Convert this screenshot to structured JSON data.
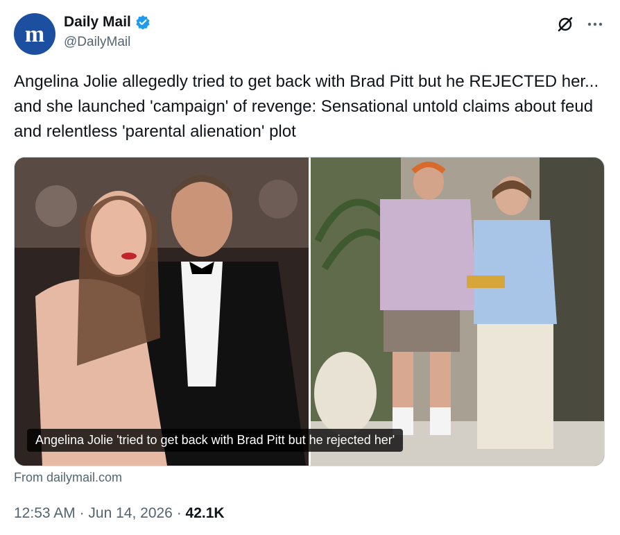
{
  "author": {
    "display_name": "Daily Mail",
    "handle": "@DailyMail",
    "avatar_letter": "m",
    "brand_color": "#1d4fa0",
    "verified_color": "#1d9bf0"
  },
  "tweet": {
    "text": "Angelina Jolie allegedly tried to get back with Brad Pitt but he REJECTED her... and she launched 'campaign' of revenge: Sensational untold claims about feud and relentless 'parental alienation' plot",
    "media_caption": "Angelina Jolie 'tried to get back with Brad Pitt but he rejected her'",
    "source": "From dailymail.com",
    "time": "12:53 AM",
    "separator": "·",
    "date": "Jun 14, 2026",
    "views": "42.1K"
  },
  "icons": {
    "grok": "grok-icon",
    "more": "more-icon",
    "verified": "verified-badge-icon"
  }
}
